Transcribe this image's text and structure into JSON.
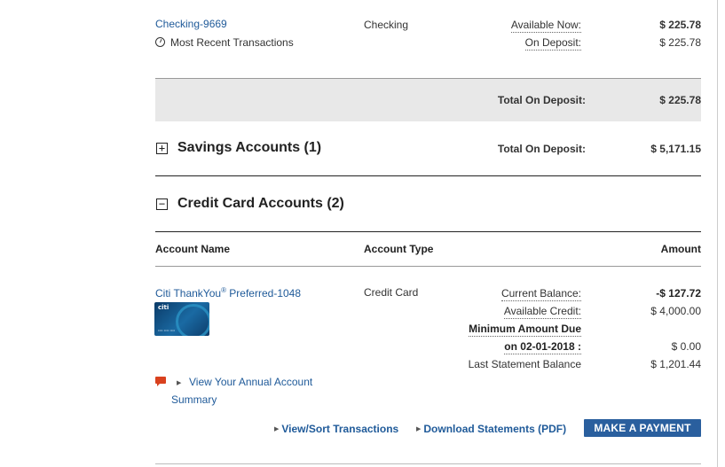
{
  "checking": {
    "account_name": "Checking-9669",
    "recent_label": "Most Recent Transactions",
    "account_type": "Checking",
    "available_label": "Available Now:",
    "available_value": "$ 225.78",
    "deposit_label": "On Deposit:",
    "deposit_value": "$ 225.78",
    "total_label": "Total On Deposit:",
    "total_value": "$ 225.78"
  },
  "savings": {
    "toggle": "+",
    "title": "Savings Accounts (1)",
    "total_label": "Total On Deposit:",
    "total_value": "$ 5,171.15"
  },
  "credit": {
    "toggle": "−",
    "title": "Credit Card Accounts (2)",
    "columns": {
      "name": "Account Name",
      "type": "Account Type",
      "amount": "Amount"
    },
    "account": {
      "name": "Citi ThankYou",
      "registered": "®",
      "name_suffix": " Preferred-1048",
      "card_brand": "citi",
      "type": "Credit Card",
      "current_balance_label": "Current Balance:",
      "current_balance_value": "-$ 127.72",
      "available_credit_label": "Available Credit:",
      "available_credit_value": "$ 4,000.00",
      "min_due_label": "Minimum Amount Due",
      "min_due_date_label": "on 02-01-2018 :",
      "min_due_value": "$ 0.00",
      "last_statement_label": "Last Statement Balance",
      "last_statement_value": "$ 1,201.44"
    },
    "annual_summary_line1": "View Your Annual Account",
    "annual_summary_line2": "Summary",
    "view_sort": "View/Sort Transactions",
    "download_statements": "Download Statements (PDF)",
    "make_payment": "MAKE A PAYMENT"
  },
  "icons": {
    "clock": "clock-icon",
    "plus": "expand-icon",
    "minus": "collapse-icon",
    "chat": "chat-icon",
    "triangle": "triangle-right-icon"
  },
  "colors": {
    "link": "#1f5a99",
    "button": "#2a5f9e",
    "chat": "#d9411e"
  }
}
